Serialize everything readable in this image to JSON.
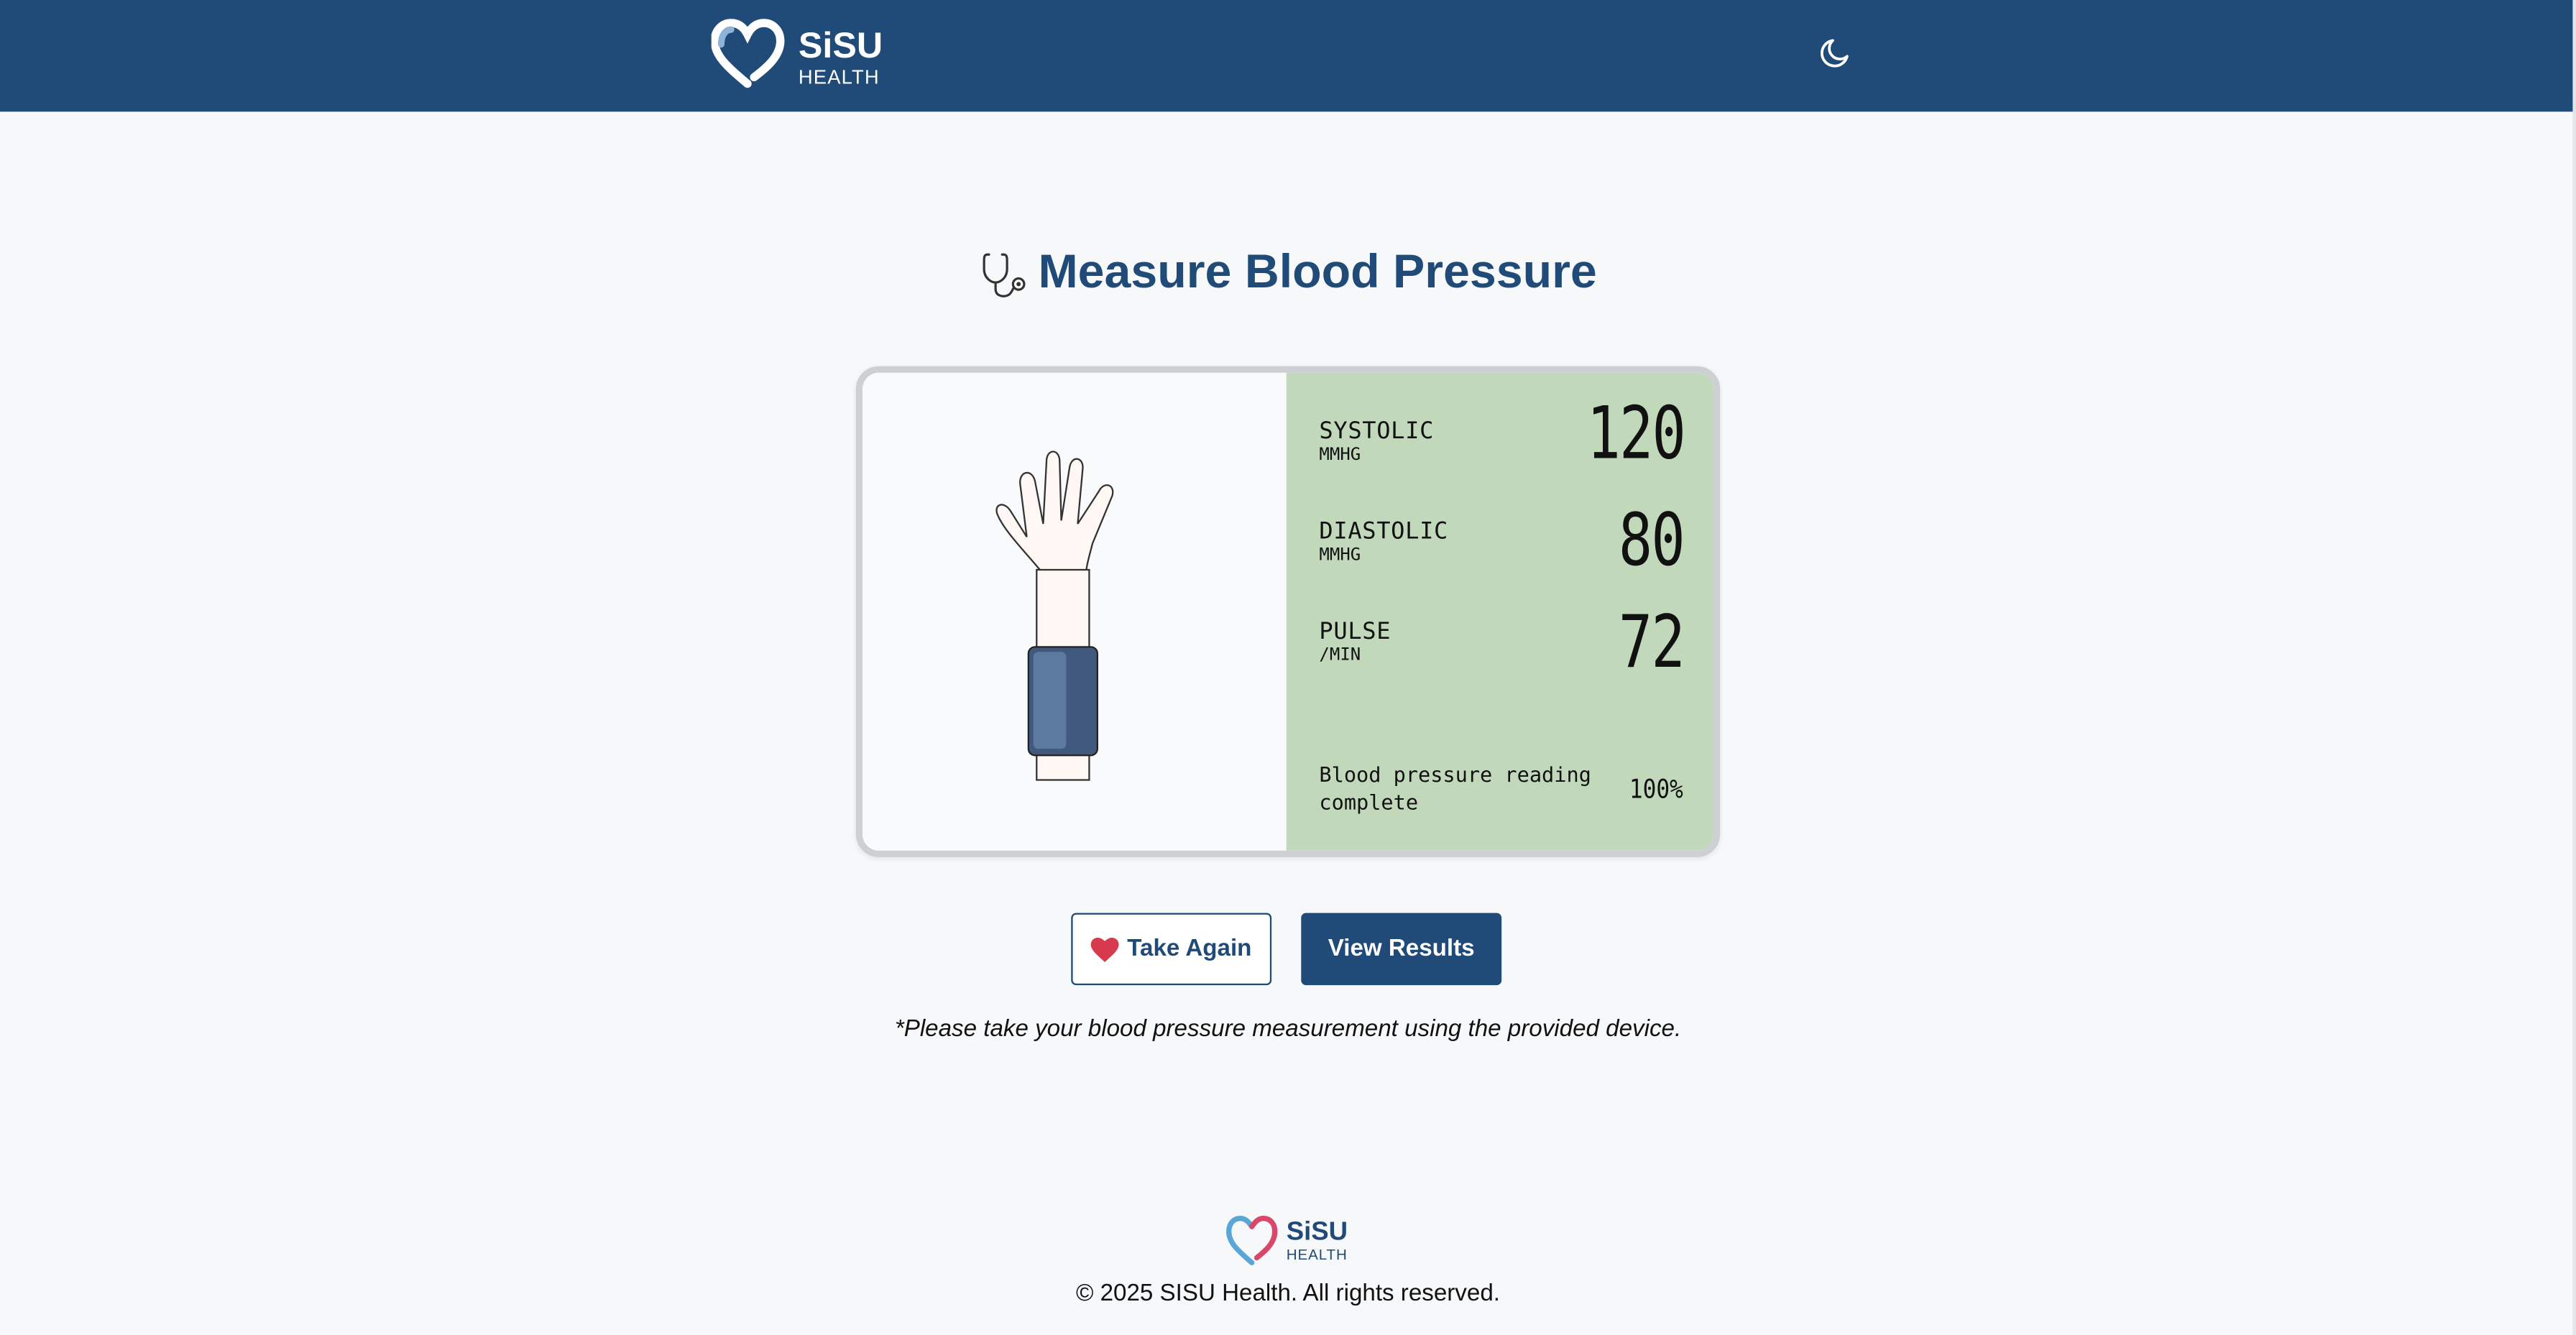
{
  "header": {
    "brand_name": "SiSU",
    "brand_sub": "HEALTH",
    "theme_toggle_icon": "moon-icon",
    "background_color": "#204b78"
  },
  "page": {
    "title_icon": "stethoscope-icon",
    "title": "Measure Blood Pressure"
  },
  "device": {
    "illustration": "arm-with-cuff",
    "readings": [
      {
        "name": "SYSTOLIC",
        "unit": "MMHG",
        "value": "120"
      },
      {
        "name": "DIASTOLIC",
        "unit": "MMHG",
        "value": "80"
      },
      {
        "name": "PULSE",
        "unit": "/MIN",
        "value": "72"
      }
    ],
    "status_text": "Blood pressure reading complete",
    "progress_text": "100%",
    "progress_value": 1.0,
    "lcd_color": "#c1d8bb"
  },
  "actions": {
    "take_again_icon": "heart-icon",
    "take_again_label": "Take Again",
    "view_results_label": "View Results"
  },
  "note": "*Please take your blood pressure measurement using the provided device.",
  "footer": {
    "brand_name": "SiSU",
    "brand_sub": "HEALTH",
    "copyright": "© 2025 SISU Health. All rights reserved."
  },
  "colors": {
    "primary": "#204b78",
    "heart_red": "#d7394d",
    "page_bg": "#f6f8fa"
  }
}
